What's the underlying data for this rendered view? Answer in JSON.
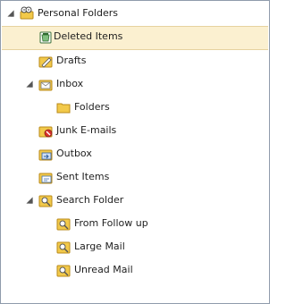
{
  "tree": {
    "root": {
      "label": "Personal Folders",
      "expanded": true
    },
    "deleted": {
      "label": "Deleted Items"
    },
    "drafts": {
      "label": "Drafts"
    },
    "inbox": {
      "label": "Inbox",
      "expanded": true
    },
    "inbox_folders": {
      "label": "Folders"
    },
    "junk": {
      "label": "Junk E-mails"
    },
    "outbox": {
      "label": "Outbox"
    },
    "sent": {
      "label": "Sent Items"
    },
    "search": {
      "label": "Search Folder",
      "expanded": true
    },
    "search_followup": {
      "label": "From Follow up"
    },
    "search_large": {
      "label": "Large Mail"
    },
    "search_unread": {
      "label": "Unread Mail"
    }
  },
  "icons": {
    "root": "personal-folders-icon",
    "deleted": "deleted-items-icon",
    "drafts": "drafts-icon",
    "inbox": "inbox-icon",
    "folder": "folder-icon",
    "junk": "junk-mail-icon",
    "outbox": "outbox-icon",
    "sent": "sent-items-icon",
    "search": "search-folder-icon"
  },
  "colors": {
    "selection_bg": "#fbf0d0",
    "selection_border": "#e6d29f",
    "folder_yellow": "#f2c94a"
  }
}
